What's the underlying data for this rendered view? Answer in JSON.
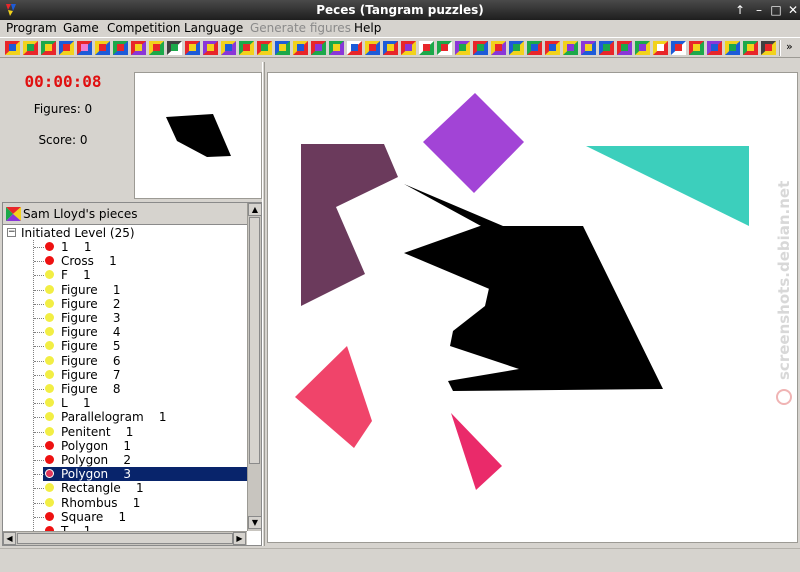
{
  "window": {
    "title": "Peces (Tangram puzzles)"
  },
  "menu": [
    {
      "label": "Program",
      "enabled": true
    },
    {
      "label": "Game",
      "enabled": true
    },
    {
      "label": "Competition",
      "enabled": true
    },
    {
      "label": "Language",
      "enabled": true
    },
    {
      "label": "Generate figures",
      "enabled": false
    },
    {
      "label": "Help",
      "enabled": true
    }
  ],
  "toolbar": {
    "buttons": [
      [
        "#e8262a",
        "#f2d21c",
        "#1d5bd8"
      ],
      [
        "#f2d21c",
        "#e8262a",
        "#1ca84a"
      ],
      [
        "#1ca84a",
        "#e8262a",
        "#f2d21c"
      ],
      [
        "#1d5bd8",
        "#f2d21c",
        "#e8262a"
      ],
      [
        "#e8262a",
        "#1d5bd8",
        "#f07ad2"
      ],
      [
        "#f2d21c",
        "#1d5bd8",
        "#e8262a"
      ],
      [
        "#1ca84a",
        "#1d5bd8",
        "#e8262a"
      ],
      [
        "#e8262a",
        "#8a36d8",
        "#f2d21c"
      ],
      [
        "#f2d21c",
        "#1ca84a",
        "#e8262a"
      ],
      [
        "#404040",
        "#ffffff",
        "#1ca84a"
      ],
      [
        "#e8262a",
        "#1d5bd8",
        "#f2d21c"
      ],
      [
        "#8a36d8",
        "#e8262a",
        "#f2d21c"
      ],
      [
        "#f2d21c",
        "#8a36d8",
        "#1d5bd8"
      ],
      [
        "#1ca84a",
        "#f2d21c",
        "#e8262a"
      ],
      [
        "#e8262a",
        "#f2d21c",
        "#1ca84a"
      ],
      [
        "#1d5bd8",
        "#1ca84a",
        "#f2d21c"
      ],
      [
        "#f2d21c",
        "#e8262a",
        "#1d5bd8"
      ],
      [
        "#e8262a",
        "#1ca84a",
        "#8a36d8"
      ],
      [
        "#1ca84a",
        "#8a36d8",
        "#f2d21c"
      ],
      [
        "#ffffff",
        "#e8262a",
        "#1d5bd8"
      ],
      [
        "#f2d21c",
        "#1d5bd8",
        "#e8262a"
      ],
      [
        "#1d5bd8",
        "#e8262a",
        "#f2d21c"
      ],
      [
        "#e8262a",
        "#f2d21c",
        "#8a36d8"
      ],
      [
        "#ffffff",
        "#1ca84a",
        "#e8262a"
      ],
      [
        "#1ca84a",
        "#ffffff",
        "#e8262a"
      ],
      [
        "#8a36d8",
        "#f2d21c",
        "#1ca84a"
      ],
      [
        "#e8262a",
        "#1d5bd8",
        "#1ca84a"
      ],
      [
        "#f2d21c",
        "#8a36d8",
        "#e8262a"
      ],
      [
        "#1d5bd8",
        "#f2d21c",
        "#1ca84a"
      ],
      [
        "#1ca84a",
        "#e8262a",
        "#1d5bd8"
      ],
      [
        "#e8262a",
        "#f2d21c",
        "#1d5bd8"
      ],
      [
        "#f2d21c",
        "#1ca84a",
        "#8a36d8"
      ],
      [
        "#8a36d8",
        "#1d5bd8",
        "#f2d21c"
      ],
      [
        "#1d5bd8",
        "#e8262a",
        "#1ca84a"
      ],
      [
        "#e8262a",
        "#8a36d8",
        "#1ca84a"
      ],
      [
        "#1ca84a",
        "#f2d21c",
        "#8a36d8"
      ],
      [
        "#f2d21c",
        "#e8262a",
        "#ffffff"
      ],
      [
        "#1d5bd8",
        "#ffffff",
        "#e8262a"
      ],
      [
        "#e8262a",
        "#1ca84a",
        "#f2d21c"
      ],
      [
        "#8a36d8",
        "#e8262a",
        "#1d5bd8"
      ],
      [
        "#f2d21c",
        "#1d5bd8",
        "#1ca84a"
      ],
      [
        "#1ca84a",
        "#e8262a",
        "#f2d21c"
      ],
      [
        "#404040",
        "#f2d21c",
        "#e8262a"
      ]
    ]
  },
  "info": {
    "timer": "00:00:08",
    "figures_text": "Figures: 0",
    "score_text": "Score: 0"
  },
  "tree": {
    "header": "Sam Lloyd's pieces",
    "root_label": "Initiated Level (25)",
    "items": [
      {
        "label": "1    1",
        "status_color": "#ee1111",
        "selected": false
      },
      {
        "label": "Cross    1",
        "status_color": "#ee1111",
        "selected": false
      },
      {
        "label": "F    1",
        "status_color": "#f2ee44",
        "selected": false
      },
      {
        "label": "Figure    1",
        "status_color": "#f2ee44",
        "selected": false
      },
      {
        "label": "Figure    2",
        "status_color": "#f2ee44",
        "selected": false
      },
      {
        "label": "Figure    3",
        "status_color": "#f2ee44",
        "selected": false
      },
      {
        "label": "Figure    4",
        "status_color": "#f2ee44",
        "selected": false
      },
      {
        "label": "Figure    5",
        "status_color": "#f2ee44",
        "selected": false
      },
      {
        "label": "Figure    6",
        "status_color": "#f2ee44",
        "selected": false
      },
      {
        "label": "Figure    7",
        "status_color": "#f2ee44",
        "selected": false
      },
      {
        "label": "Figure    8",
        "status_color": "#f2ee44",
        "selected": false
      },
      {
        "label": "L    1",
        "status_color": "#f2ee44",
        "selected": false
      },
      {
        "label": "Parallelogram    1",
        "status_color": "#f2ee44",
        "selected": false
      },
      {
        "label": "Penitent    1",
        "status_color": "#f2ee44",
        "selected": false
      },
      {
        "label": "Polygon    1",
        "status_color": "#ee1111",
        "selected": false
      },
      {
        "label": "Polygon    2",
        "status_color": "#ee1111",
        "selected": false
      },
      {
        "label": "Polygon    3",
        "status_color": "#e0365a",
        "selected": true
      },
      {
        "label": "Rectangle    1",
        "status_color": "#f2ee44",
        "selected": false
      },
      {
        "label": "Rhombus    1",
        "status_color": "#f2ee44",
        "selected": false
      },
      {
        "label": "Square    1",
        "status_color": "#ee1111",
        "selected": false
      },
      {
        "label": "T    1",
        "status_color": "#ee1111",
        "selected": false
      }
    ]
  },
  "pieces": [
    {
      "name": "purple-square",
      "color": "#a244d6"
    },
    {
      "name": "plum-l-piece",
      "color": "#6b3a5c"
    },
    {
      "name": "teal-triangle",
      "color": "#3ccfbc"
    },
    {
      "name": "red-quad",
      "color": "#f0446a"
    },
    {
      "name": "pink-triangle",
      "color": "#ea2a6a"
    }
  ],
  "target_color": "#000000",
  "watermark": "screenshots.debian.net"
}
